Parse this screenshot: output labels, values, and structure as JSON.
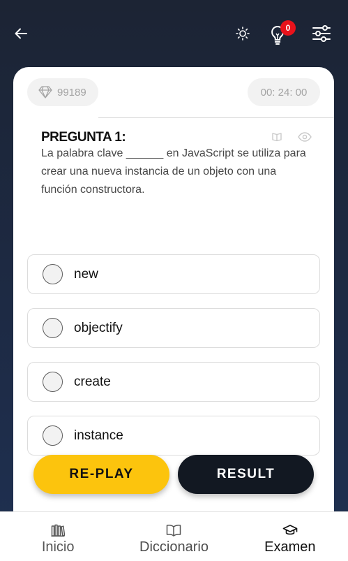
{
  "header": {
    "back_icon": "arrow-left-icon",
    "theme_icon": "sun-icon",
    "hint_icon": "lightbulb-icon",
    "hint_count": "0",
    "settings_icon": "sliders-icon"
  },
  "stats": {
    "gems_icon": "diamond-icon",
    "gems": "99189",
    "timer": "00: 24: 00"
  },
  "question": {
    "title": "PREGUNTA 1:",
    "text": "La palabra clave ______ en JavaScript se utiliza para crear una nueva instancia de un objeto con una función constructora.",
    "book_icon": "book-icon",
    "eye_icon": "eye-icon"
  },
  "options": [
    {
      "label": "new"
    },
    {
      "label": "objectify"
    },
    {
      "label": "create"
    },
    {
      "label": "instance"
    }
  ],
  "actions": {
    "replay": "RE-PLAY",
    "result": "RESULT"
  },
  "nav": {
    "inicio": {
      "label": "Inicio",
      "icon": "library-icon"
    },
    "diccionario": {
      "label": "Diccionario",
      "icon": "open-book-icon"
    },
    "examen": {
      "label": "Examen",
      "icon": "graduation-cap-icon"
    },
    "active": "Examen"
  },
  "colors": {
    "accent_yellow": "#fcc40d",
    "dark_button": "#121822",
    "badge_red": "#e8121b",
    "background": "#1d2a44"
  }
}
